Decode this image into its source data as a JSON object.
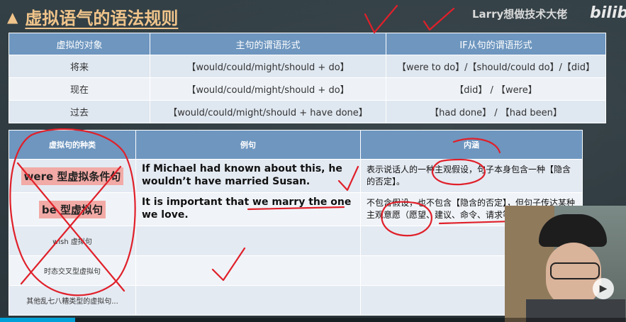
{
  "header": {
    "title": "虚拟语气的语法规则",
    "brand": "Larry想做技术大佬",
    "site_logo": "bilibili"
  },
  "table_top": {
    "headers": [
      "虚拟的对象",
      "主句的谓语形式",
      "IF从句的谓语形式"
    ],
    "rows": [
      [
        "将来",
        "【would/could/might/should + do】",
        "【were to do】/【should/could  do】/【did】"
      ],
      [
        "现在",
        "【would/could/might/should + do】",
        "【did】 / 【were】"
      ],
      [
        "过去",
        "【would/could/might/should + have done】",
        "【had done】 / 【had been】"
      ]
    ]
  },
  "table_bottom": {
    "headers": [
      "虚拟句的种类",
      "例句",
      "内涵"
    ],
    "rows": [
      {
        "type": "were 型虚拟条件句",
        "example": "If Michael had known about this, he wouldn’t have married Susan.",
        "meaning": "表示说话人的一种主观假设，句子本身包含一种【隐含的否定】。"
      },
      {
        "type": "be 型虚拟句",
        "example": "It is important that we marry the one we love.",
        "meaning": "不包含假设，也不包含【隐含的否定】，但句子传达某种主观意愿（愿望、建议、命令、请求等）"
      },
      {
        "type": "wish 虚拟句",
        "example": "",
        "meaning": ""
      },
      {
        "type": "时态交叉型虚拟句",
        "example": "",
        "meaning": ""
      },
      {
        "type": "其他乱七八糟类型的虚拟句...",
        "example": "",
        "meaning": ""
      }
    ]
  },
  "video": {
    "progress": 0.12
  },
  "colors": {
    "title": "#f0c48a",
    "header_blue": "#6e96bf",
    "highlight_pink": "#f2aaa6",
    "annotation_red": "#e0202a",
    "progress_blue": "#00a1d6"
  }
}
